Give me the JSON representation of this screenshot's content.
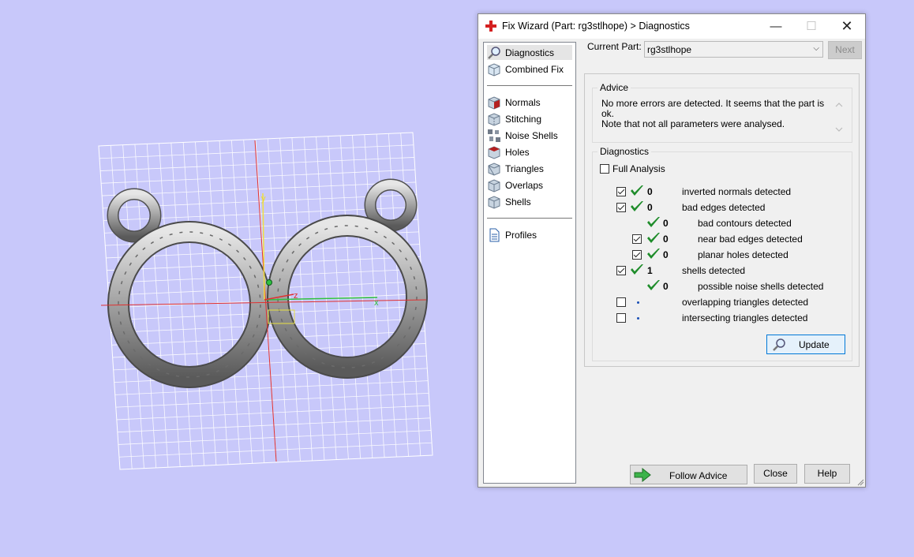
{
  "viewport": {
    "axis_labels": {
      "x": "x",
      "y": "y",
      "z": "z"
    },
    "colors": {
      "background": "#c8c8fa",
      "grid": "#ffffff",
      "x_axis": "#e03030",
      "y_axis": "#f0e040",
      "z_axis": "#30c040",
      "model": "#9a9a9a"
    }
  },
  "window": {
    "title": "Fix Wizard (Part: rg3stlhope) > Diagnostics",
    "controls": {
      "minimize": "—",
      "maximize": "☐",
      "close": "✕"
    }
  },
  "nav": {
    "top": [
      {
        "label": "Diagnostics",
        "icon": "magnifier-icon",
        "selected": true
      },
      {
        "label": "Combined Fix",
        "icon": "cube-icon"
      }
    ],
    "tools": [
      {
        "label": "Normals",
        "icon": "normals-cube-icon"
      },
      {
        "label": "Stitching",
        "icon": "stitching-cube-icon"
      },
      {
        "label": "Noise Shells",
        "icon": "noise-shells-icon"
      },
      {
        "label": "Holes",
        "icon": "holes-cube-icon"
      },
      {
        "label": "Triangles",
        "icon": "triangles-cube-icon"
      },
      {
        "label": "Overlaps",
        "icon": "overlaps-cube-icon"
      },
      {
        "label": "Shells",
        "icon": "shells-cube-icon"
      }
    ],
    "bottom": [
      {
        "label": "Profiles",
        "icon": "profiles-document-icon"
      }
    ]
  },
  "part": {
    "label": "Current Part:",
    "value": "rg3stlhope",
    "next_label": "Next"
  },
  "advice": {
    "title": "Advice",
    "line1": "No more errors are detected. It seems that the part is ok.",
    "line2": "Note that not all parameters were analysed."
  },
  "diagnostics": {
    "title": "Diagnostics",
    "full_analysis_label": "Full Analysis",
    "rows": [
      {
        "checked": true,
        "status": "ok",
        "count": "0",
        "label": "inverted normals detected"
      },
      {
        "checked": true,
        "status": "ok",
        "count": "0",
        "label": "bad edges detected"
      },
      {
        "checked": null,
        "status": "ok",
        "count": "0",
        "label": "bad contours detected"
      },
      {
        "checked": true,
        "status": "ok",
        "count": "0",
        "label": "near bad edges detected"
      },
      {
        "checked": true,
        "status": "ok",
        "count": "0",
        "label": "planar holes detected"
      },
      {
        "checked": true,
        "status": "ok",
        "count": "1",
        "label": "shells detected"
      },
      {
        "checked": null,
        "status": "ok",
        "count": "0",
        "label": "possible noise shells detected"
      },
      {
        "checked": false,
        "status": "none",
        "count": "",
        "label": "overlapping triangles detected"
      },
      {
        "checked": false,
        "status": "none",
        "count": "",
        "label": "intersecting triangles detected"
      }
    ],
    "update_label": "Update"
  },
  "footer": {
    "follow_advice_label": "Follow Advice",
    "close_label": "Close",
    "help_label": "Help"
  },
  "colors": {
    "accent": "#0078d7",
    "ok_check": "#1e8c2a",
    "title_icon": "#d42020"
  }
}
